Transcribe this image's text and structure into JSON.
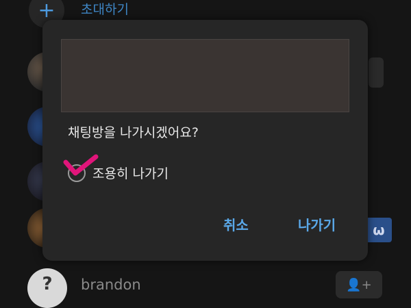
{
  "background": {
    "invite_label": "초대하기",
    "invite_icon": "+",
    "members": [
      {
        "name": "brandon",
        "avatar_glyph": "?"
      }
    ],
    "add_friend_icon": "👤+",
    "watermark_glyph": "ω"
  },
  "dialog": {
    "message": "채팅방을 나가시겠어요?",
    "quiet_leave_label": "조용히 나가기",
    "quiet_leave_checked": true,
    "cancel_label": "취소",
    "leave_label": "나가기"
  },
  "colors": {
    "accent": "#5aa8e8",
    "checkmark": "#e0157a",
    "dialog_bg": "#262626"
  }
}
